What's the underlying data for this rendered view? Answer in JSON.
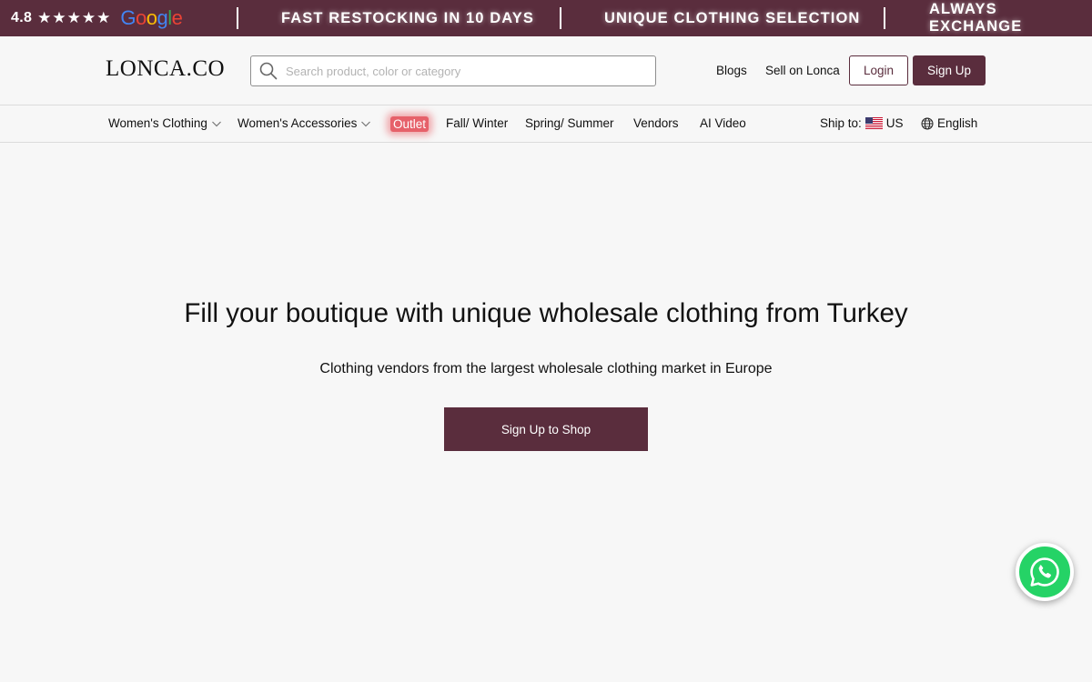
{
  "topbar": {
    "rating": "4.8",
    "stars": "★★★★★",
    "google_letters": [
      "G",
      "o",
      "o",
      "g",
      "l",
      "e"
    ],
    "promos": [
      "FAST RESTOCKING IN 10 DAYS",
      "UNIQUE CLOTHING SELECTION",
      "ALWAYS EXCHANGE"
    ],
    "background_color": "#5a2d3d"
  },
  "header": {
    "logo": "LONCA.CO",
    "search_placeholder": "Search product, color or category",
    "links": {
      "blogs": "Blogs",
      "sell": "Sell on Lonca"
    },
    "login_label": "Login",
    "signup_label": "Sign Up"
  },
  "categories": {
    "womens_clothing": "Women's Clothing",
    "womens_accessories": "Women's Accessories",
    "outlet": "Outlet",
    "fall_winter": "Fall/ Winter",
    "spring_summer": "Spring/ Summer",
    "vendors": "Vendors",
    "ai_video": "AI Video",
    "ship_to_label": "Ship to:",
    "ship_to_country": "US",
    "language": "English"
  },
  "hero": {
    "title": "Fill your boutique with unique wholesale clothing from Turkey",
    "subtitle": "Clothing vendors from the largest wholesale clothing market in Europe",
    "cta_label": "Sign Up to Shop"
  },
  "colors": {
    "brand": "#5a2d3d",
    "outlet_highlight": "#e6616a",
    "whatsapp": "#25d366"
  },
  "icons": {
    "search": "search-icon",
    "chevron": "chevron-down-icon",
    "flag": "us-flag-icon",
    "globe": "globe-icon",
    "whatsapp": "whatsapp-icon"
  }
}
